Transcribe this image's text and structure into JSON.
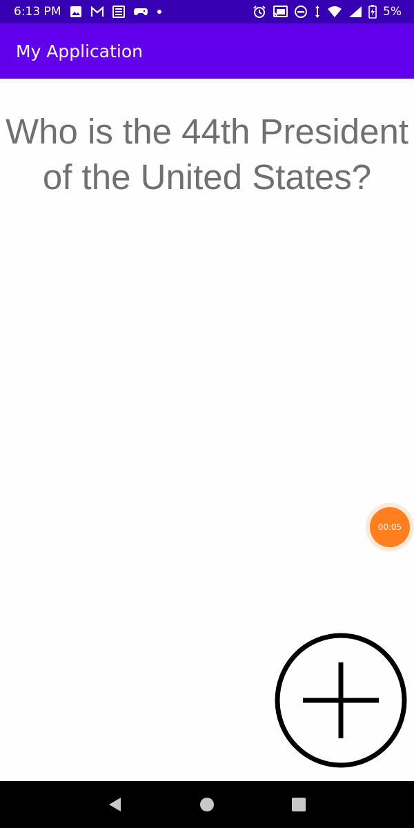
{
  "status_bar": {
    "time": "6:13 PM",
    "battery": "5%",
    "left_icons": [
      "image-icon",
      "gmail-icon",
      "news-icon",
      "game-icon",
      "dot-icon"
    ],
    "right_icons": [
      "alarm-icon",
      "cast-icon",
      "dnd-icon",
      "data-arrows-icon",
      "wifi-icon",
      "signal-icon",
      "battery-icon"
    ]
  },
  "app_bar": {
    "title": "My Application"
  },
  "question": {
    "text": "Who is the 44th President of the United States?"
  },
  "timer": {
    "label": "00:05",
    "color": "#ff7f1f"
  },
  "add_button": {
    "icon": "plus-circle-icon"
  },
  "navigation": {
    "buttons": [
      "back-icon",
      "home-icon",
      "recents-icon"
    ]
  },
  "colors": {
    "status_bar": "#3700b3",
    "app_bar": "#6200ee",
    "question_text": "#707070"
  }
}
